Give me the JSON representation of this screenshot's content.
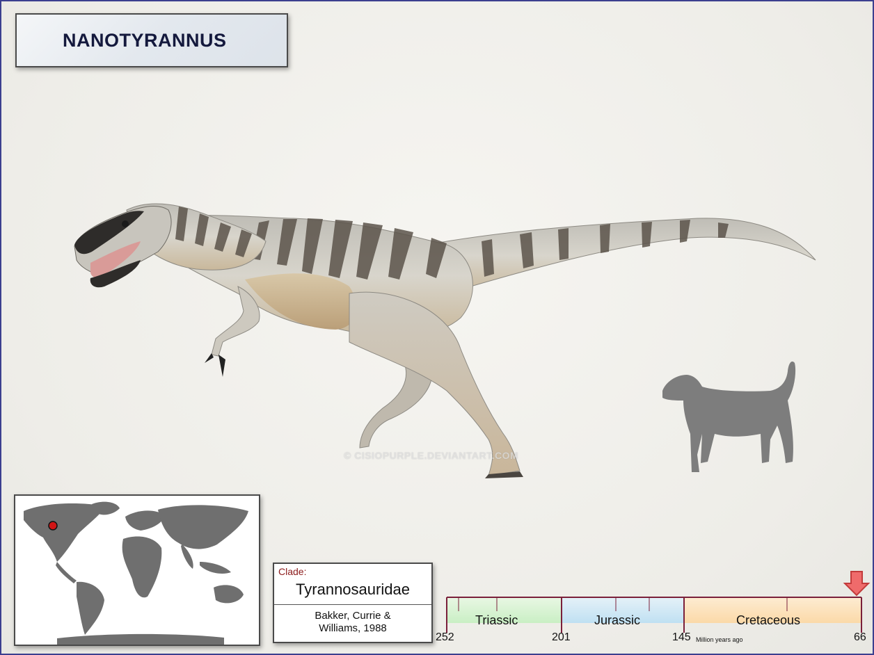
{
  "title": "NANOTYRANNUS",
  "watermark": "© CISIOPURPLE.DEVIANTART.COM",
  "clade": {
    "label": "Clade:",
    "name": "Tyrannosauridae",
    "author_line1": "Bakker, Currie &",
    "author_line2": "Williams, 1988"
  },
  "timeline": {
    "periods": [
      "Triassic",
      "Jurassic",
      "Cretaceous"
    ],
    "ticks": [
      "252",
      "201",
      "145",
      "66"
    ],
    "unit": "Million years ago",
    "colors": {
      "triassic": "#c9efc4",
      "jurassic": "#bfe0f2",
      "cretaceous": "#fbd9a8",
      "axis": "#7a1f3a",
      "marker": "#ef6b6b"
    }
  },
  "colors": {
    "frame": "#3b3f8f",
    "title_text": "#14193d",
    "map_land": "#6f6f6f",
    "locality": "#d01515",
    "scale_silhouette": "#7d7d7d"
  },
  "icons": [
    "world-map",
    "locality-marker-icon",
    "dog-silhouette-icon",
    "arrow-down-icon"
  ]
}
